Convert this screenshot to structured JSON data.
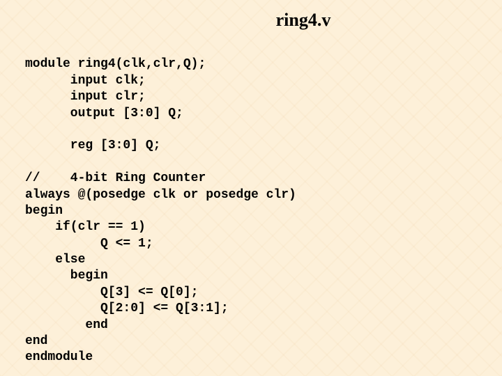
{
  "title": "ring4.v",
  "code": {
    "l1": "module ring4(clk,clr,Q);",
    "l2": "      input clk;",
    "l3": "      input clr;",
    "l4": "      output [3:0] Q;",
    "l5": "",
    "l6": "      reg [3:0] Q;",
    "l7": "",
    "l8": "//    4-bit Ring Counter",
    "l9": "always @(posedge clk or posedge clr)",
    "l10": "begin",
    "l11": "    if(clr == 1)",
    "l12": "          Q <= 1;",
    "l13": "    else",
    "l14": "      begin",
    "l15": "          Q[3] <= Q[0];",
    "l16": "          Q[2:0] <= Q[3:1];",
    "l17": "        end",
    "l18": "end",
    "l19": "endmodule"
  }
}
